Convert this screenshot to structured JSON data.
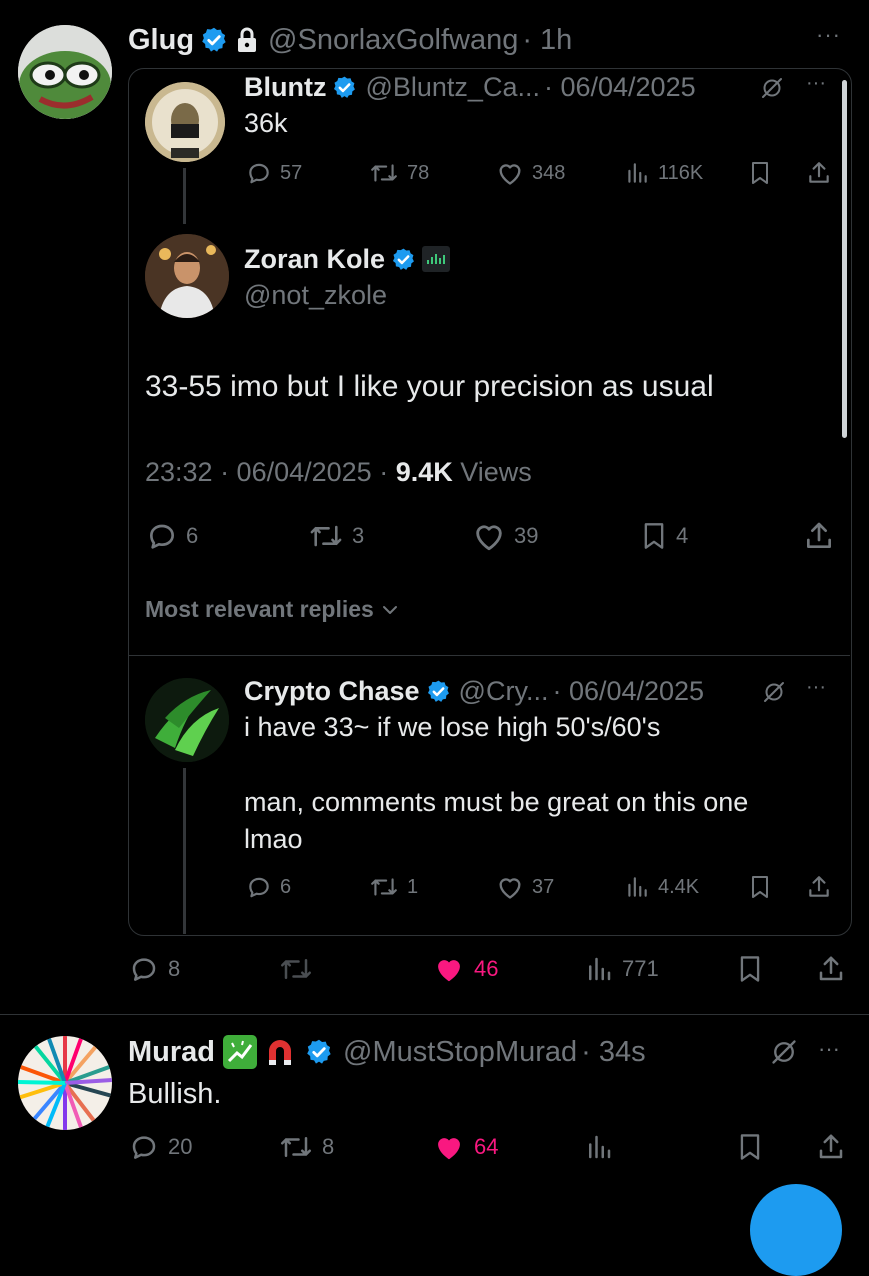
{
  "tweet1": {
    "name": "Glug",
    "handle": "@SnorlaxGolfwang",
    "time": "· 1h",
    "more": "···",
    "actions": {
      "reply": "8",
      "repost": "",
      "like": "46",
      "views": "771"
    }
  },
  "quote": {
    "bluntz": {
      "name": "Bluntz",
      "handle": "@Bluntz_Ca...",
      "date": "· 06/04/2025",
      "text": "36k",
      "actions": {
        "reply": "57",
        "repost": "78",
        "like": "348",
        "views": "116K"
      }
    },
    "zoran": {
      "name": "Zoran Kole",
      "handle": "@not_zkole",
      "text": "33-55 imo but I like your precision as usual",
      "time": "23:32 · 06/04/2025 · ",
      "views_count": "9.4K",
      "views_label": " Views",
      "actions": {
        "reply": "6",
        "repost": "3",
        "like": "39",
        "bookmark": "4"
      }
    },
    "relevant": "Most relevant replies",
    "chase": {
      "name": "Crypto Chase",
      "handle": "@Cry...",
      "date": "· 06/04/2025",
      "text1": "i have 33~ if we lose high 50's/60's",
      "text2": "man, comments must be great on this one",
      "text3": "lmao",
      "actions": {
        "reply": "6",
        "repost": "1",
        "like": "37",
        "views": "4.4K"
      }
    }
  },
  "tweet2": {
    "name": "Murad",
    "handle": "@MustStopMurad",
    "time": "· 34s",
    "text": "Bullish.",
    "actions": {
      "reply": "20",
      "repost": "8",
      "like": "64",
      "views": ""
    }
  },
  "colors": {
    "bg": "#000000",
    "muted": "#71767b",
    "verified": "#1d9bf0",
    "like": "#f91880",
    "text": "#e7e9ea"
  }
}
